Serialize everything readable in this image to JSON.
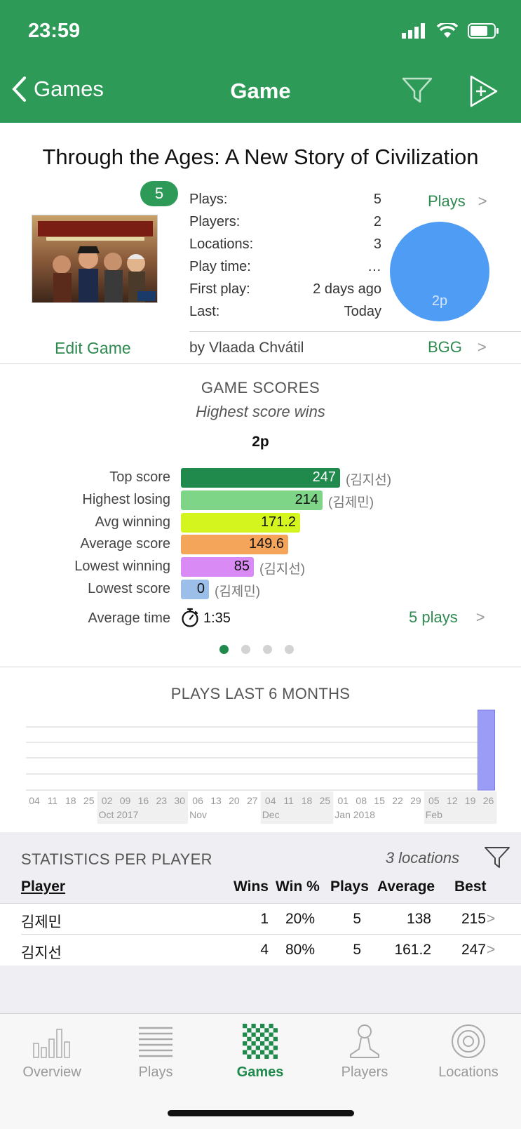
{
  "status_bar": {
    "time": "23:59"
  },
  "nav": {
    "back_label": "Games",
    "title": "Game"
  },
  "game": {
    "title": "Through the Ages: A New Story of Civilization",
    "plays_badge": "5",
    "stats": [
      {
        "label": "Plays:",
        "value": "5"
      },
      {
        "label": "Players:",
        "value": "2"
      },
      {
        "label": "Locations:",
        "value": "3"
      },
      {
        "label": "Play time:",
        "value": "…"
      },
      {
        "label": "First play:",
        "value": "2 days ago"
      },
      {
        "label": "Last:",
        "value": "Today"
      }
    ],
    "plays_link": "Plays",
    "pie_label": "2p",
    "edit_label": "Edit Game",
    "designer": "by Vlaada Chvátil",
    "bgg_link": "BGG",
    "chevron": ">"
  },
  "scores": {
    "title": "GAME SCORES",
    "subtitle": "Highest score wins",
    "player_count": "2p",
    "rows": [
      {
        "label": "Top score",
        "value": "247",
        "player": "(김지선)",
        "color": "#1f8a4c",
        "text_color": "#ffffff",
        "fraction": 1.0
      },
      {
        "label": "Highest losing",
        "value": "214",
        "player": "(김제민)",
        "color": "#7ed487",
        "text_color": "#111111",
        "fraction": 0.866
      },
      {
        "label": "Avg winning",
        "value": "171.2",
        "player": "",
        "color": "#d4f51e",
        "text_color": "#111111",
        "fraction": 0.693
      },
      {
        "label": "Average score",
        "value": "149.6",
        "player": "",
        "color": "#f5a55a",
        "text_color": "#111111",
        "fraction": 0.606
      },
      {
        "label": "Lowest winning",
        "value": "85",
        "player": "(김지선)",
        "color": "#d98af5",
        "text_color": "#111111",
        "fraction": 0.344
      },
      {
        "label": "Lowest score",
        "value": "0",
        "player": "(김제민)",
        "color": "#9cbfe9",
        "text_color": "#111111",
        "fraction": 0.0
      }
    ],
    "avg_time_label": "Average time",
    "avg_time": "1:35",
    "plays_link": "5 plays"
  },
  "chart_data": {
    "type": "bar",
    "title": "PLAYS LAST 6 MONTHS",
    "categories": [
      "04",
      "11",
      "18",
      "25",
      "02",
      "09",
      "16",
      "23",
      "30",
      "06",
      "13",
      "20",
      "27",
      "04",
      "11",
      "18",
      "25",
      "01",
      "08",
      "15",
      "22",
      "29",
      "05",
      "12",
      "19",
      "26"
    ],
    "month_labels": [
      "Oct 2017",
      "Nov",
      "Dec",
      "Jan 2018",
      "Feb"
    ],
    "values": [
      0,
      0,
      0,
      0,
      0,
      0,
      0,
      0,
      0,
      0,
      0,
      0,
      0,
      0,
      0,
      0,
      0,
      0,
      0,
      0,
      0,
      0,
      0,
      0,
      0,
      5
    ],
    "bar_color": "#9b9cf5",
    "grid": true
  },
  "player_stats": {
    "title": "STATISTICS PER PLAYER",
    "locations": "3 locations",
    "headers": {
      "player": "Player",
      "wins": "Wins",
      "win_pct": "Win %",
      "plays": "Plays",
      "average": "Average",
      "best": "Best"
    },
    "rows": [
      {
        "player": "김제민",
        "wins": "1",
        "win_pct": "20%",
        "plays": "5",
        "average": "138",
        "best": "215"
      },
      {
        "player": "김지선",
        "wins": "4",
        "win_pct": "80%",
        "plays": "5",
        "average": "161.2",
        "best": "247"
      }
    ]
  },
  "tabs": [
    {
      "label": "Overview",
      "icon": "bar-chart-icon",
      "active": false
    },
    {
      "label": "Plays",
      "icon": "list-icon",
      "active": false
    },
    {
      "label": "Games",
      "icon": "checkerboard-icon",
      "active": true
    },
    {
      "label": "Players",
      "icon": "pawn-icon",
      "active": false
    },
    {
      "label": "Locations",
      "icon": "target-icon",
      "active": false
    }
  ],
  "colors": {
    "brand": "#2e9a57",
    "link": "#2e8a50",
    "pie": "#4f9cf5"
  }
}
